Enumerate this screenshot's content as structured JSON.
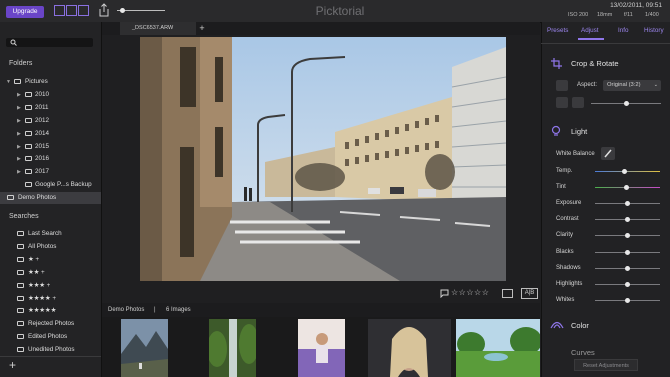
{
  "topbar": {
    "upgrade_label": "Upgrade",
    "app_title": "Picktorial",
    "date_time": "13/02/2011, 09:51",
    "iso": "ISO 200",
    "focal": "18mm",
    "aperture": "f/11",
    "shutter": "1/400"
  },
  "tabs": {
    "file": "_DSC6537.ARW",
    "add": "+"
  },
  "sidebar": {
    "folders_label": "Folders",
    "folders": [
      {
        "label": "Pictures",
        "level": 0,
        "expanded": true
      },
      {
        "label": "2010",
        "level": 1
      },
      {
        "label": "2011",
        "level": 1
      },
      {
        "label": "2012",
        "level": 1
      },
      {
        "label": "2014",
        "level": 1
      },
      {
        "label": "2015",
        "level": 1
      },
      {
        "label": "2016",
        "level": 1
      },
      {
        "label": "2017",
        "level": 1
      },
      {
        "label": "Google P...s Backup",
        "level": 1
      },
      {
        "label": "Demo Photos",
        "level": 0,
        "selected": true
      }
    ],
    "searches_label": "Searches",
    "searches": [
      {
        "label": "Last Search"
      },
      {
        "label": "All Photos"
      },
      {
        "label": "★ +"
      },
      {
        "label": "★★ +"
      },
      {
        "label": "★★★ +"
      },
      {
        "label": "★★★★ +"
      },
      {
        "label": "★★★★★"
      },
      {
        "label": "Rejected Photos"
      },
      {
        "label": "Edited Photos"
      },
      {
        "label": "Unedited Photos"
      }
    ],
    "add_label": "+"
  },
  "viewer": {
    "rating": 0,
    "stars": "☆☆☆☆☆",
    "ab_label": "A|B"
  },
  "filmstrip": {
    "album": "Demo Photos",
    "separator": "|",
    "count": "6 Images"
  },
  "right_panel": {
    "tabs": [
      "Presets",
      "Adjust",
      "Info",
      "History"
    ],
    "crop_title": "Crop & Rotate",
    "aspect_label": "Aspect:",
    "aspect_value": "Original (3:2)",
    "light_title": "Light",
    "white_balance": "White Balance",
    "sliders": [
      {
        "label": "Temp.",
        "value": 0.45
      },
      {
        "label": "Tint",
        "value": 0.48
      },
      {
        "label": "Exposure",
        "value": 0.5
      },
      {
        "label": "Contrast",
        "value": 0.5
      },
      {
        "label": "Clarity",
        "value": 0.5
      },
      {
        "label": "Blacks",
        "value": 0.5
      },
      {
        "label": "Shadows",
        "value": 0.5
      },
      {
        "label": "Highlights",
        "value": 0.5
      },
      {
        "label": "Whites",
        "value": 0.5
      }
    ],
    "color_title": "Color",
    "curves_title": "Curves",
    "reset_label": "Reset Adjustments"
  },
  "colors": {
    "accent": "#8f76ea",
    "upgrade": "#6a45c8"
  }
}
